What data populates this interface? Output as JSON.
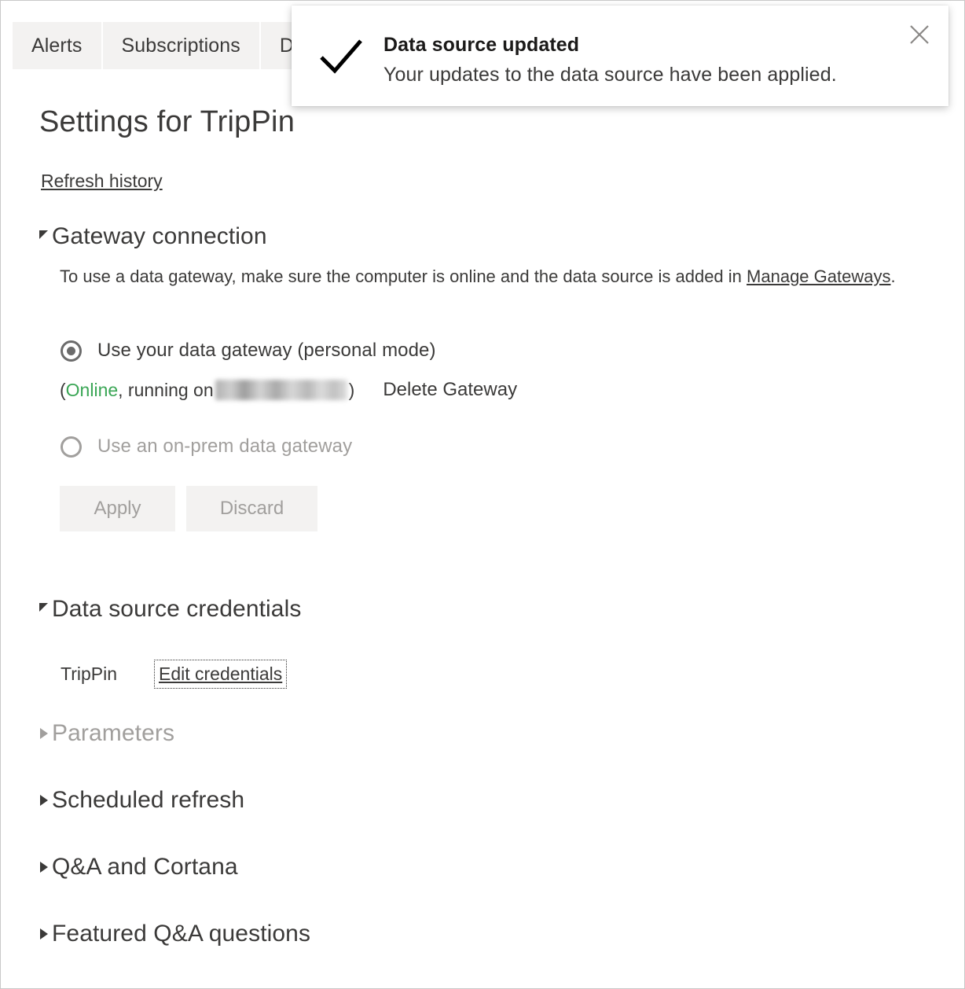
{
  "tabs": [
    {
      "label": "Alerts",
      "clipped": false
    },
    {
      "label": "Subscriptions",
      "clipped": false
    },
    {
      "label": "D",
      "clipped": true
    }
  ],
  "page": {
    "title": "Settings for TripPin",
    "refresh_history_label": "Refresh history"
  },
  "gateway": {
    "section_title": "Gateway connection",
    "description_prefix": "To use a data gateway, make sure the computer is online and the data source is added in ",
    "description_link": "Manage Gateways",
    "description_suffix": ".",
    "option_personal": "Use your data gateway (personal mode)",
    "option_onprem": "Use an on-prem data gateway",
    "status_open_paren": "(",
    "status_online": "Online",
    "status_running_on": ", running on ",
    "status_host_redacted": "",
    "status_close_paren": ")",
    "delete_label": "Delete Gateway",
    "apply_label": "Apply",
    "discard_label": "Discard",
    "online_color": "#3aa655"
  },
  "credentials": {
    "section_title": "Data source credentials",
    "source_name": "TripPin",
    "edit_label": "Edit credentials"
  },
  "collapsed_sections": [
    {
      "label": "Parameters",
      "disabled": true
    },
    {
      "label": "Scheduled refresh",
      "disabled": false
    },
    {
      "label": "Q&A and Cortana",
      "disabled": false
    },
    {
      "label": "Featured Q&A questions",
      "disabled": false
    }
  ],
  "toast": {
    "title": "Data source updated",
    "message": "Your updates to the data source have been applied.",
    "icon": "check-icon",
    "close_icon": "close-icon"
  }
}
